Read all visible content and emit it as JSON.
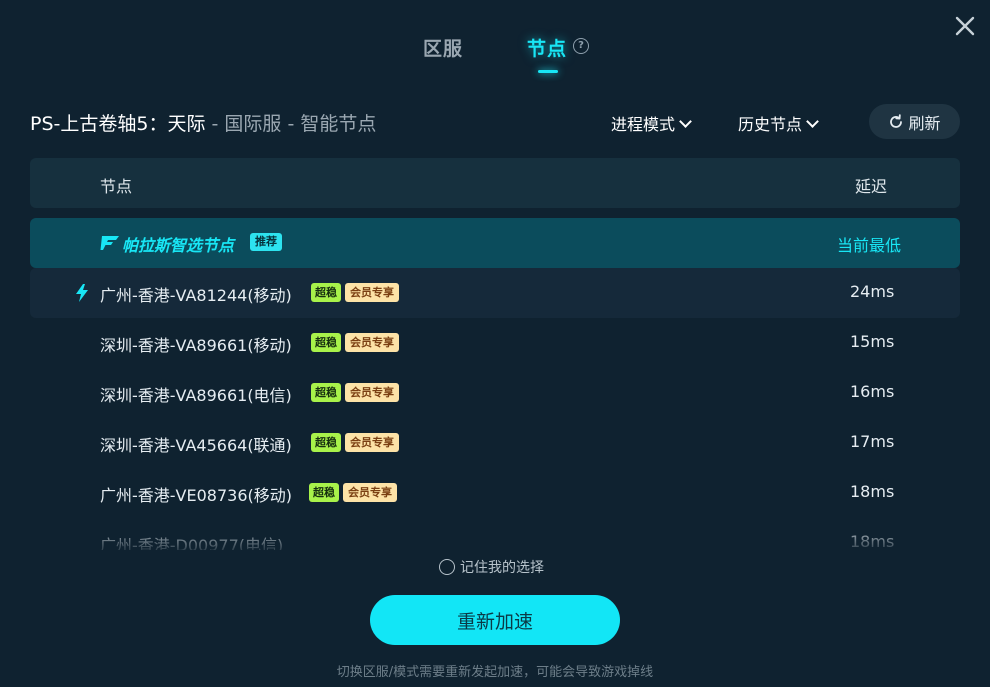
{
  "tabs": {
    "region": "区服",
    "nodes": "节点"
  },
  "game": {
    "name": "PS-上古卷轴5：天际",
    "sub": " - 国际服 - 智能节点"
  },
  "controls": {
    "mode": "进程模式",
    "history": "历史节点",
    "refresh": "刷新"
  },
  "table": {
    "col_node": "节点",
    "col_latency": "延迟"
  },
  "recommended": {
    "label": "帕拉斯智选节点",
    "badge": "推荐",
    "latency": "当前最低"
  },
  "badges": {
    "super": "超稳",
    "vip": "会员专享"
  },
  "nodes": [
    {
      "name": "广州-香港-VA81244(移动)",
      "latency": "24ms",
      "selected": true
    },
    {
      "name": "深圳-香港-VA89661(移动)",
      "latency": "15ms"
    },
    {
      "name": "深圳-香港-VA89661(电信)",
      "latency": "16ms"
    },
    {
      "name": "深圳-香港-VA45664(联通)",
      "latency": "17ms"
    },
    {
      "name": "广州-香港-VE08736(移动)",
      "latency": "18ms"
    },
    {
      "name": "广州-香港-D00977(电信)",
      "latency": "18ms"
    }
  ],
  "remember": "记住我的选择",
  "accelerate_button": "重新加速",
  "footer_note": "切换区服/模式需要重新发起加速，可能会导致游戏掉线",
  "colors": {
    "accent": "#18e6f5",
    "background": "#0f2230",
    "super_badge": "#a8f24a",
    "vip_badge": "#fde3a7"
  }
}
